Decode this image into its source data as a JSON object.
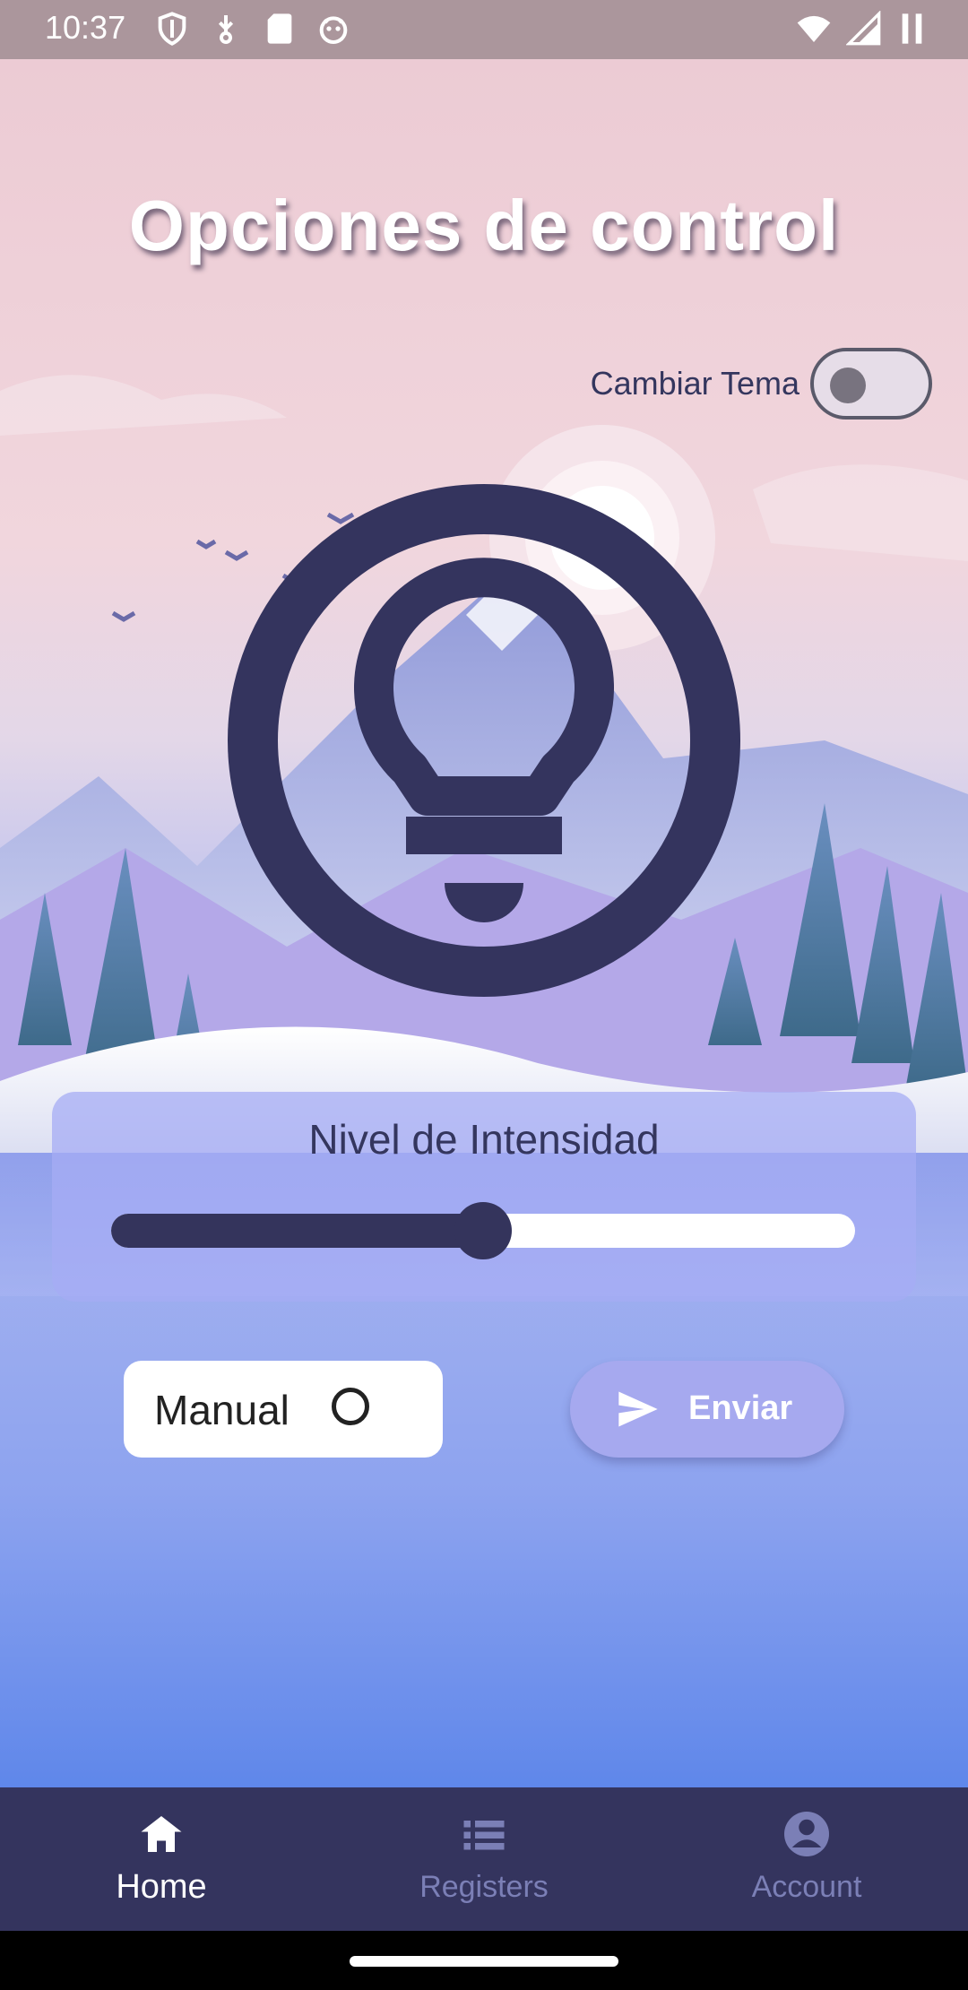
{
  "status_bar": {
    "time": "10:37",
    "left_icons": [
      "shield-icon",
      "usb-icon",
      "sd-card-icon",
      "robot-icon"
    ],
    "right_icons": [
      "wifi-icon",
      "signal-icon",
      "battery-icon"
    ]
  },
  "header": {
    "title": "Opciones de control"
  },
  "theme": {
    "label": "Cambiar Tema",
    "enabled": false
  },
  "intensity": {
    "label": "Nivel de Intensidad",
    "value": 0.5
  },
  "controls": {
    "manual_label": "Manual",
    "manual_selected": false,
    "send_label": "Enviar"
  },
  "bottom_nav": {
    "items": [
      {
        "label": "Home",
        "icon": "home-icon",
        "active": true
      },
      {
        "label": "Registers",
        "icon": "list-icon",
        "active": false
      },
      {
        "label": "Account",
        "icon": "account-icon",
        "active": false
      }
    ]
  },
  "colors": {
    "primary": "#34345e",
    "accent": "#a6a9ef",
    "status_bar": "#ab969c"
  }
}
